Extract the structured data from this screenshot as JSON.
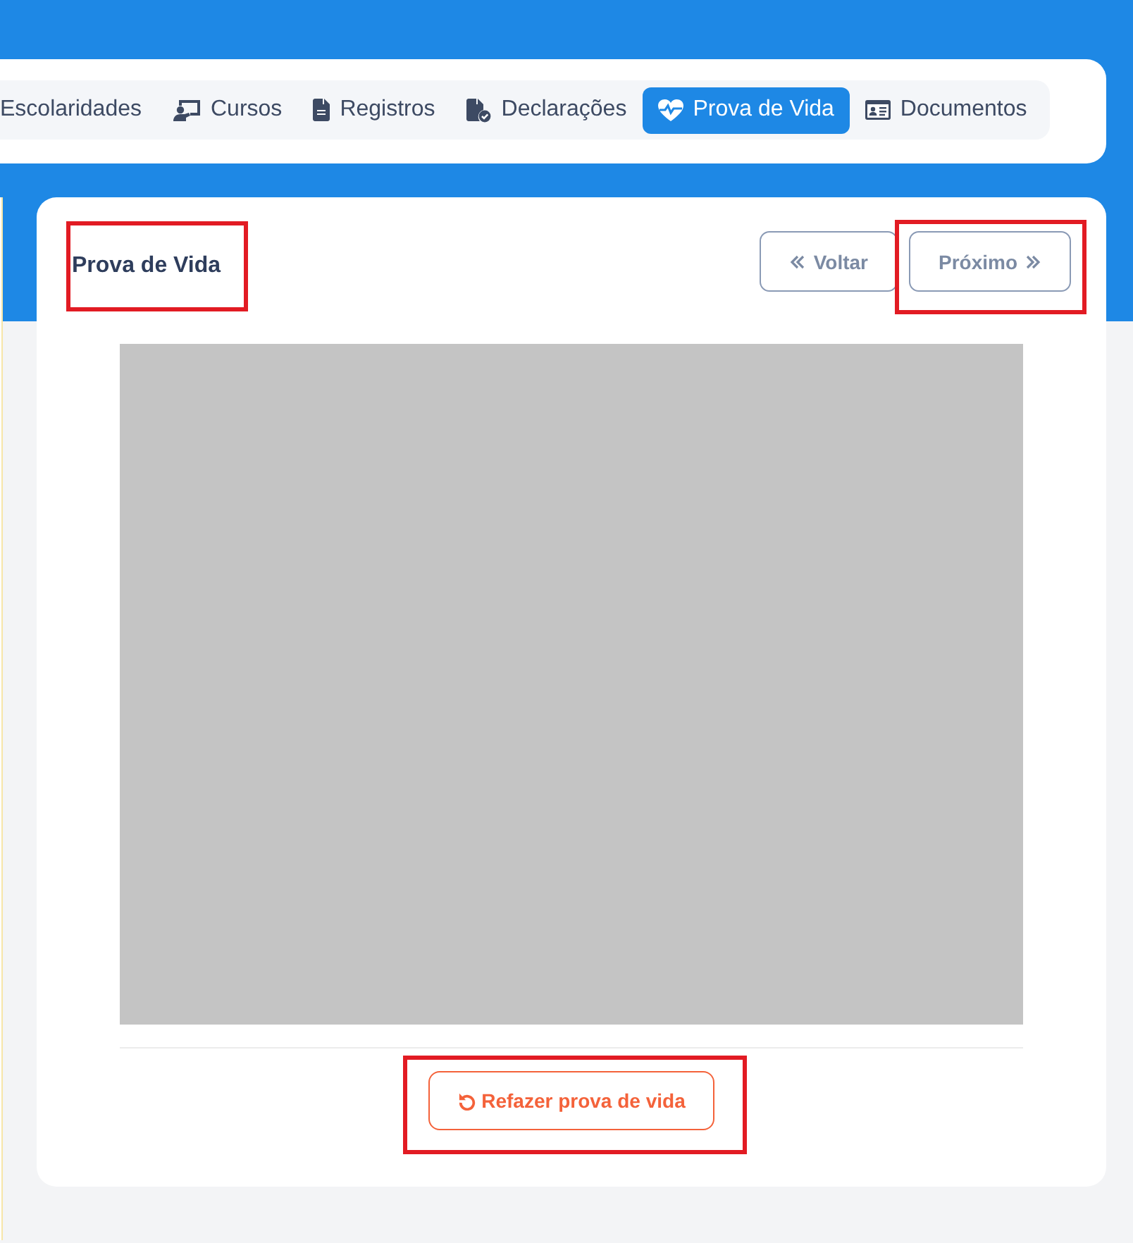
{
  "tabs": [
    {
      "label": "Escolaridades",
      "selected": false
    },
    {
      "label": "Cursos",
      "selected": false
    },
    {
      "label": "Registros",
      "selected": false
    },
    {
      "label": "Declarações",
      "selected": false
    },
    {
      "label": "Prova de Vida",
      "selected": true
    },
    {
      "label": "Documentos",
      "selected": false
    }
  ],
  "panel": {
    "title": {
      "text": "Prova de Vida",
      "highlighted": true
    },
    "buttons": [
      {
        "kind": "back",
        "label": "Voltar",
        "highlighted": false
      },
      {
        "kind": "next",
        "label": "Próximo",
        "highlighted": true
      }
    ],
    "redo_button": {
      "label": "Refazer prova de vida",
      "highlighted": true
    }
  }
}
